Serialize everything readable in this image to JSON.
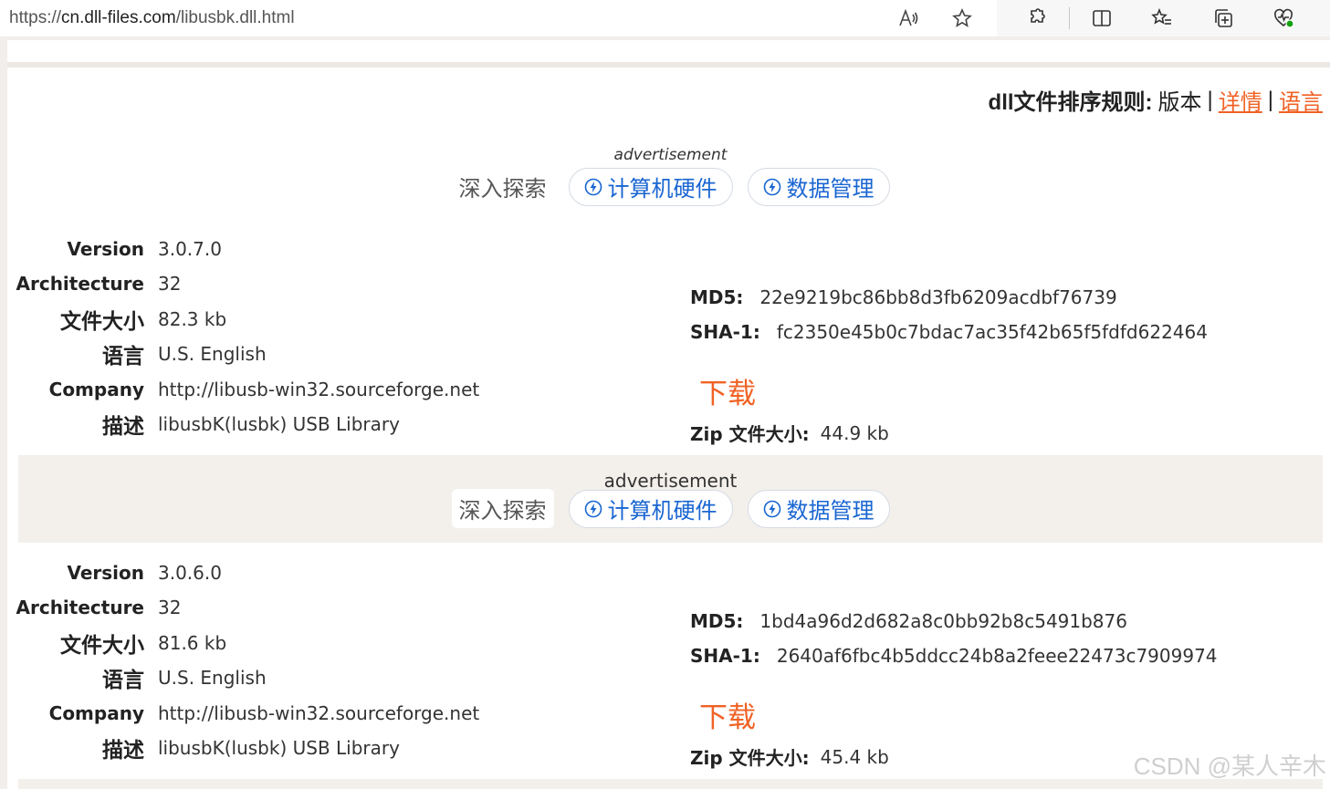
{
  "browser": {
    "url_scheme": "https://",
    "url_host": "cn.dll-files.com",
    "url_path": "/libusbk.dll.html",
    "icons": [
      "read-aloud-icon",
      "favorite-star-icon",
      "extensions-icon",
      "split-screen-icon",
      "favorites-icon",
      "collections-icon",
      "browser-essentials-icon"
    ]
  },
  "sort_rule": {
    "label": "dll文件排序规则:",
    "option_version": "版本",
    "option_details": "详情",
    "option_language": "语言",
    "separator": "|"
  },
  "ads": [
    {
      "label": "advertisement",
      "plain": "深入探索",
      "chip1": "计算机硬件",
      "chip2": "数据管理"
    },
    {
      "label": "advertisement",
      "plain": "深入探索",
      "chip1": "计算机硬件",
      "chip2": "数据管理"
    }
  ],
  "labels": {
    "version": "Version",
    "architecture": "Architecture",
    "file_size": "文件大小",
    "language": "语言",
    "company": "Company",
    "description": "描述",
    "md5": "MD5:",
    "sha1": "SHA-1:",
    "download": "下载",
    "zip_size": "Zip 文件大小:"
  },
  "entries": [
    {
      "version": "3.0.7.0",
      "architecture": "32",
      "file_size": "82.3 kb",
      "language": "U.S. English",
      "company": "http://libusb-win32.sourceforge.net",
      "description": "libusbK(lusbk) USB Library",
      "md5": "22e9219bc86bb8d3fb6209acdbf76739",
      "sha1": "fc2350e45b0c7bdac7ac35f42b65f5fdfd622464",
      "zip_size": "44.9 kb"
    },
    {
      "version": "3.0.6.0",
      "architecture": "32",
      "file_size": "81.6 kb",
      "language": "U.S. English",
      "company": "http://libusb-win32.sourceforge.net",
      "description": "libusbK(lusbk) USB Library",
      "md5": "1bd4a96d2d682a8c0bb92b8c5491b876",
      "sha1": "2640af6fbc4b5ddcc24b8a2feee22473c7909974",
      "zip_size": "45.4 kb"
    }
  ],
  "watermark": "CSDN @某人辛木"
}
